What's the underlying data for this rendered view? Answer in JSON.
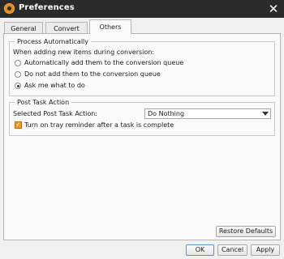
{
  "window": {
    "title": "Preferences",
    "close_glyph": "✕"
  },
  "tabs": [
    {
      "label": "General"
    },
    {
      "label": "Convert"
    },
    {
      "label": "Others"
    }
  ],
  "process_auto": {
    "legend": "Process Automatically",
    "prompt": "When adding new items during conversion:",
    "options": [
      {
        "label": "Automatically add them to the conversion queue",
        "selected": false
      },
      {
        "label": "Do not add them to the conversion queue",
        "selected": false
      },
      {
        "label": "Ask me what to do",
        "selected": true
      }
    ]
  },
  "post_task": {
    "legend": "Post Task Action",
    "selected_label": "Selected Post Task Action:",
    "selected_value": "Do Nothing",
    "tray_reminder_label": "Turn on tray reminder after a task is complete",
    "tray_reminder_checked": true
  },
  "buttons": {
    "restore": "Restore Defaults",
    "ok": "OK",
    "cancel": "Cancel",
    "apply": "Apply"
  },
  "colors": {
    "titlebar": "#2b2b2b",
    "accent": "#e79a3c"
  }
}
